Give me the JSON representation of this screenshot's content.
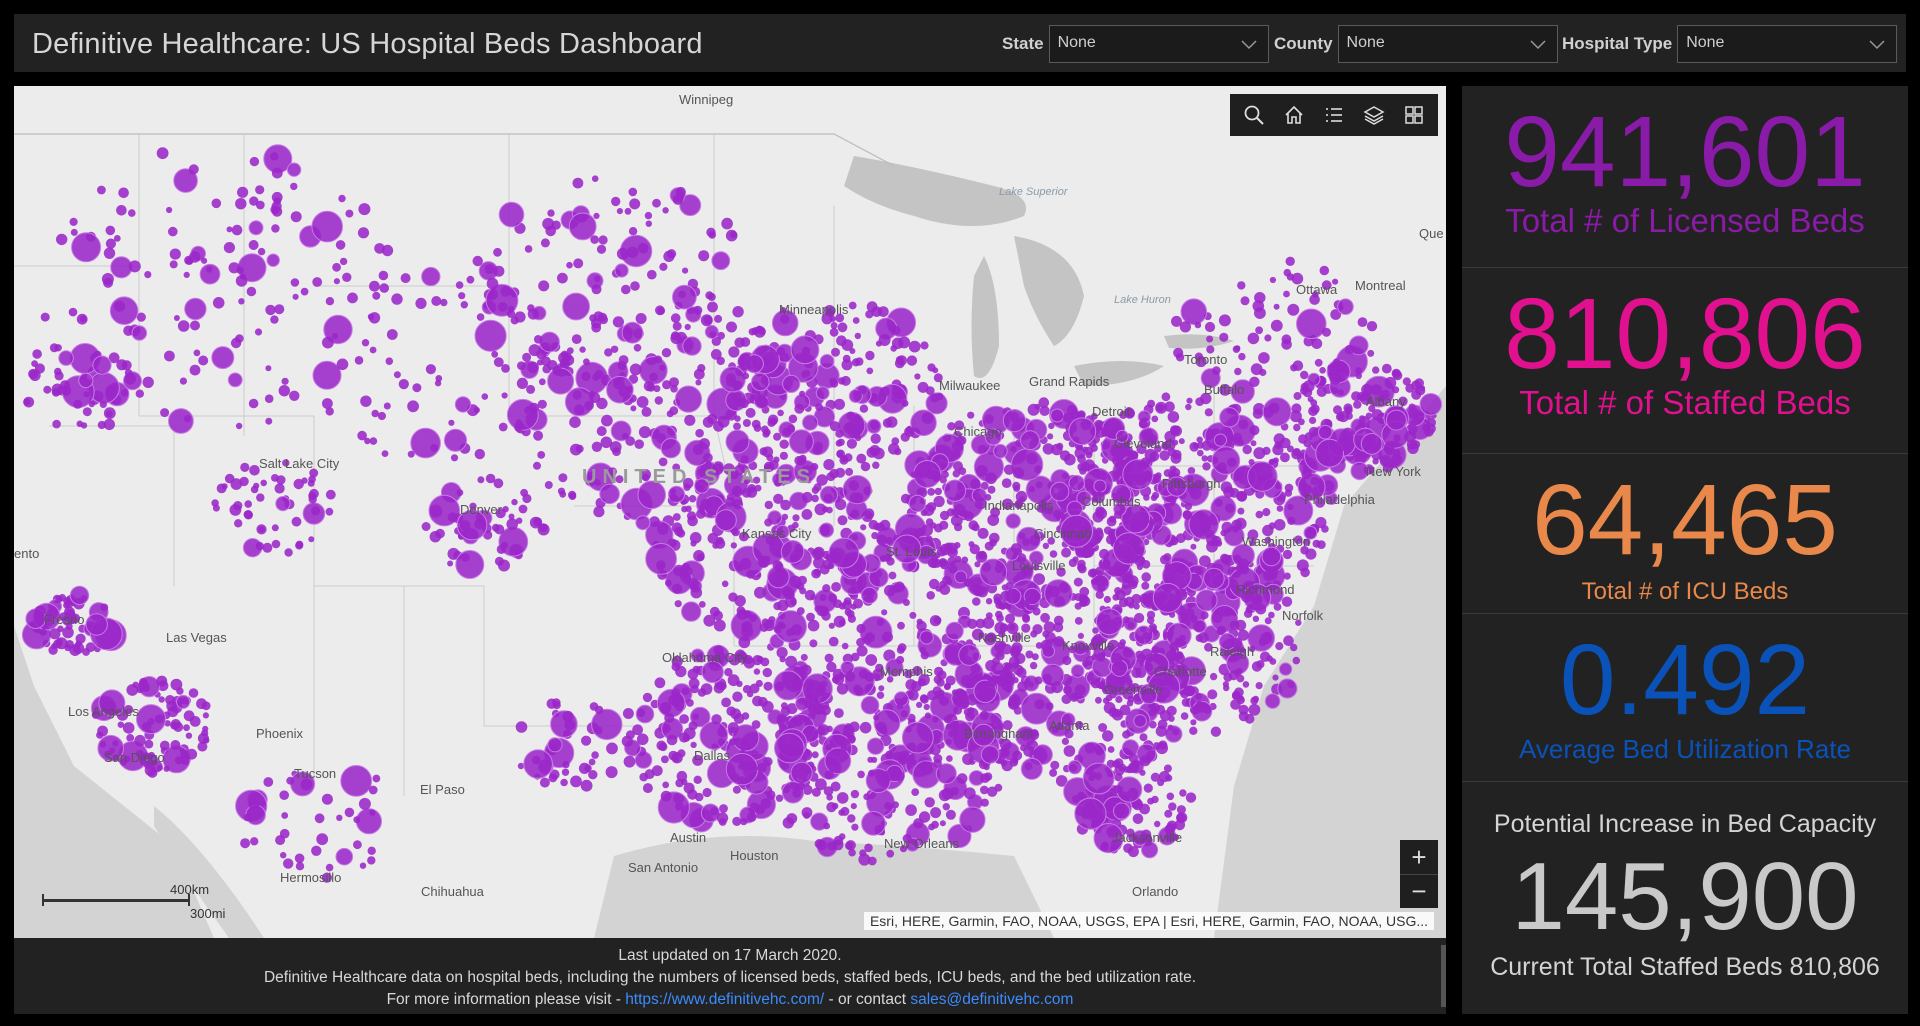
{
  "header": {
    "title": "Definitive Healthcare: US Hospital Beds Dashboard",
    "filters": [
      {
        "label": "State",
        "value": "None"
      },
      {
        "label": "County",
        "value": "None"
      },
      {
        "label": "Hospital Type",
        "value": "None"
      }
    ]
  },
  "map": {
    "attribution": "Esri, HERE, Garmin, FAO, NOAA, USGS, EPA | Esri, HERE, Garmin, FAO, NOAA, USG...",
    "scale": {
      "km": "400km",
      "mi": "300mi"
    },
    "toolbar": [
      "search-icon",
      "home-icon",
      "legend-icon",
      "layers-icon",
      "basemap-gallery-icon"
    ],
    "zoom": {
      "in": "+",
      "out": "−"
    },
    "dot_color": "#9b27c8",
    "labels": {
      "winnipeg": "Winnipeg",
      "lake_superior": "Lake Superior",
      "ottawa": "Ottawa",
      "montreal": "Montreal",
      "quebec": "Que",
      "lake_huron": "Lake Huron",
      "toronto": "Toronto",
      "minneapolis": "Minneapolis",
      "milwaukee": "Milwaukee",
      "chicago": "Chicago",
      "detroit": "Detroit",
      "cleveland": "Cleveland",
      "pittsburgh": "Pittsburgh",
      "new_york": "New York",
      "philadelphia": "Philadelphia",
      "washington": "Washington",
      "richmond": "Richmond",
      "norfolk": "Norfolk",
      "albany": "Albany",
      "united_states": "UNITED STATES",
      "salt_lake_city": "Salt Lake City",
      "denver": "Denver",
      "kansas_city": "Kansas City",
      "st_louis": "St. Louis",
      "indianapolis": "Indianapolis",
      "columbus": "Columbus",
      "cincinnati": "Cincinnati",
      "louisville": "Louisville",
      "nashville": "Nashville",
      "knoxville": "Knoxville",
      "charlotte": "Charlotte",
      "raleigh": "Raleigh",
      "greenville": "Greenville",
      "memphis": "Memphis",
      "atlanta": "Atlanta",
      "birmingham": "Birmingham",
      "jacksonville": "Jacksonville",
      "orlando": "Orlando",
      "new_orleans": "New Orleans",
      "houston": "Houston",
      "austin": "Austin",
      "san_antonio": "San Antonio",
      "dallas": "Dallas",
      "oklahoma_city": "Oklahoma City",
      "el_paso": "El Paso",
      "tucson": "Tucson",
      "phoenix": "Phoenix",
      "las_vegas": "Las Vegas",
      "los_angeles": "Los Angeles",
      "san_diego": "San Diego",
      "fresno": "Fresno",
      "sacramento": "ento",
      "hermosillo": "Hermosillo",
      "chihuahua": "Chihuahua",
      "buffalo": "Buffalo",
      "grand_rapids": "Grand Rapids"
    }
  },
  "footer": {
    "updated": "Last updated on 17 March 2020.",
    "description": "Definitive Healthcare data on hospital beds, including the numbers of licensed beds, staffed beds, ICU beds, and the bed utilization rate.",
    "more_prefix": "For more information please visit - ",
    "link": "https://www.definitivehc.com/",
    "contact_prefix": " - or contact ",
    "email": "sales@definitivehc.com"
  },
  "stats": {
    "licensed": {
      "value": "941,601",
      "label": "Total # of Licensed Beds",
      "color": "#8a1aa8"
    },
    "staffed": {
      "value": "810,806",
      "label": "Total # of Staffed Beds",
      "color": "#e0108f"
    },
    "icu": {
      "value": "64,465",
      "label": "Total # of ICU Beds",
      "color": "#e8884a"
    },
    "utilization": {
      "value": "0.492",
      "label": "Average Bed Utilization Rate",
      "color": "#0a52b8"
    },
    "capacity": {
      "caption": "Potential Increase in Bed Capacity",
      "value": "145,900",
      "sub": "Current Total Staffed Beds 810,806"
    }
  }
}
